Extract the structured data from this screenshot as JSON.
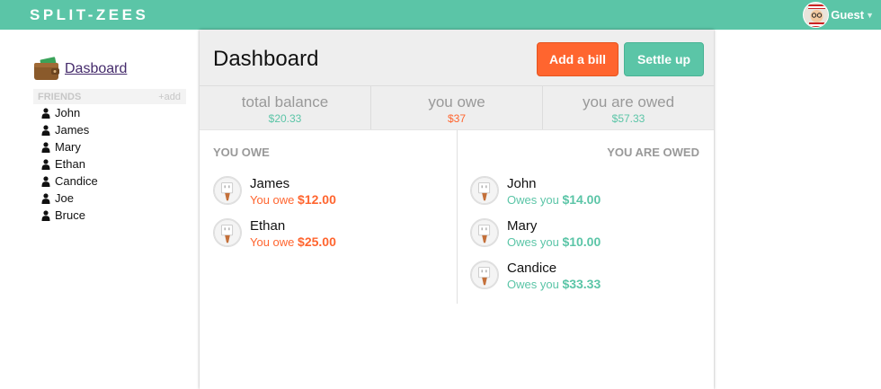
{
  "app": {
    "logo": "SPLIT-ZEES",
    "user": "Guest"
  },
  "sidebar": {
    "dashboard_label": "Dasboard",
    "friends_header": "FRIENDS",
    "add_label": "+add",
    "friends": [
      "John",
      "James",
      "Mary",
      "Ethan",
      "Candice",
      "Joe",
      "Bruce"
    ]
  },
  "main": {
    "title": "Dashboard",
    "add_bill_label": "Add a bill",
    "settle_label": "Settle up",
    "balances": {
      "total": {
        "label": "total balance",
        "value": "$20.33"
      },
      "owe": {
        "label": "you owe",
        "value": "$37"
      },
      "owed": {
        "label": "you are owed",
        "value": "$57.33"
      }
    },
    "you_owe_title": "YOU OWE",
    "you_are_owed_title": "YOU ARE OWED",
    "you_owe": [
      {
        "name": "James",
        "prefix": "You owe",
        "amount": "$12.00"
      },
      {
        "name": "Ethan",
        "prefix": "You owe",
        "amount": "$25.00"
      }
    ],
    "owed_to_you": [
      {
        "name": "John",
        "prefix": "Owes you",
        "amount": "$14.00"
      },
      {
        "name": "Mary",
        "prefix": "Owes you",
        "amount": "$10.00"
      },
      {
        "name": "Candice",
        "prefix": "Owes you",
        "amount": "$33.33"
      }
    ]
  },
  "colors": {
    "brand": "#5bc5a7",
    "accent": "#ff652f",
    "link": "#442a6b"
  }
}
